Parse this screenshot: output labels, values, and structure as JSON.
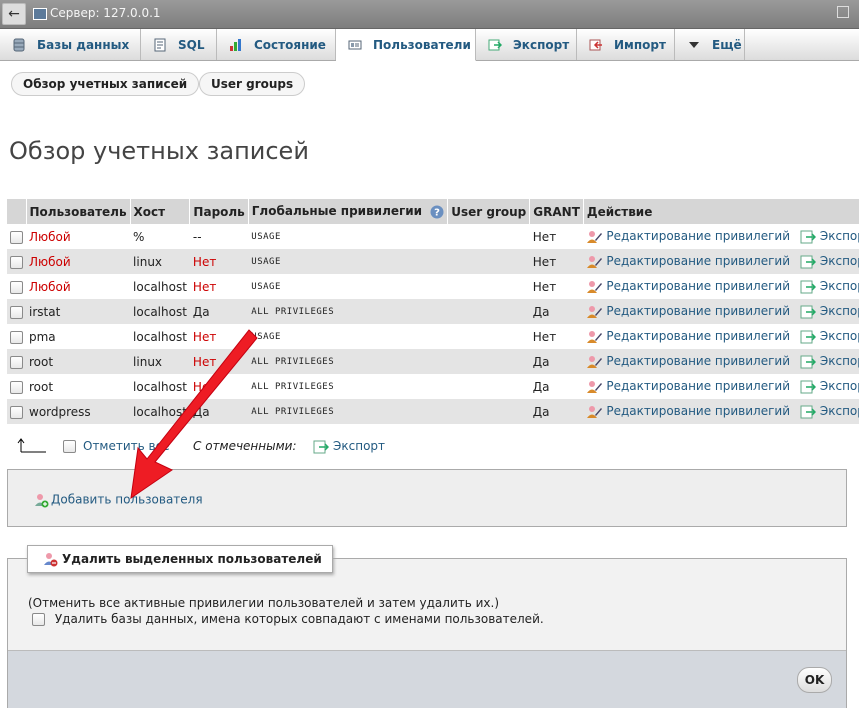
{
  "window": {
    "title": "Сервер: 127.0.0.1"
  },
  "tabs": [
    {
      "label": "Базы данных",
      "icon": "databases-icon"
    },
    {
      "label": "SQL",
      "icon": "sql-icon"
    },
    {
      "label": "Состояние",
      "icon": "status-icon"
    },
    {
      "label": "Пользователи",
      "icon": "users-icon",
      "active": true
    },
    {
      "label": "Экспорт",
      "icon": "export-icon"
    },
    {
      "label": "Импорт",
      "icon": "import-icon"
    },
    {
      "label": "Ещё",
      "icon": "chevron-down-icon"
    }
  ],
  "subtabs": [
    {
      "label": "Обзор учетных записей"
    },
    {
      "label": "User groups"
    }
  ],
  "page_title": "Обзор учетных записей",
  "table": {
    "headers": [
      "Пользователь",
      "Хост",
      "Пароль",
      "Глобальные привилегии",
      "User group",
      "GRANT",
      "Действие"
    ],
    "rows": [
      {
        "user": "Любой",
        "host": "%",
        "password": "--",
        "privileges": "USAGE",
        "group": "",
        "grant": "Нет"
      },
      {
        "user": "Любой",
        "host": "linux",
        "password": "Нет",
        "privileges": "USAGE",
        "group": "",
        "grant": "Нет"
      },
      {
        "user": "Любой",
        "host": "localhost",
        "password": "Нет",
        "privileges": "USAGE",
        "group": "",
        "grant": "Нет"
      },
      {
        "user": "irstat",
        "host": "localhost",
        "password": "Да",
        "privileges": "ALL PRIVILEGES",
        "group": "",
        "grant": "Да"
      },
      {
        "user": "pma",
        "host": "localhost",
        "password": "Нет",
        "privileges": "USAGE",
        "group": "",
        "grant": "Нет"
      },
      {
        "user": "root",
        "host": "linux",
        "password": "Нет",
        "privileges": "ALL PRIVILEGES",
        "group": "",
        "grant": "Да"
      },
      {
        "user": "root",
        "host": "localhost",
        "password": "Нет",
        "privileges": "ALL PRIVILEGES",
        "group": "",
        "grant": "Да"
      },
      {
        "user": "wordpress",
        "host": "localhost",
        "password": "Да",
        "privileges": "ALL PRIVILEGES",
        "group": "",
        "grant": "Да"
      }
    ],
    "edit_label": "Редактирование привилегий",
    "export_label": "Экспорт"
  },
  "selection": {
    "check_all_label": "Отметить все",
    "with_selected_label": "С отмеченными:",
    "export_label": "Экспорт"
  },
  "add_user": {
    "label": "Добавить пользователя"
  },
  "delete": {
    "legend": "Удалить выделенных пользователей",
    "note": "(Отменить все активные привилегии пользователей и затем удалить их.)",
    "drop_db_label": "Удалить базы данных, имена которых совпадают с именами пользователей.",
    "ok_label": "OK"
  },
  "colors": {
    "link": "#235a81",
    "red": "#cc0000",
    "arrow": "#ee1c24"
  }
}
